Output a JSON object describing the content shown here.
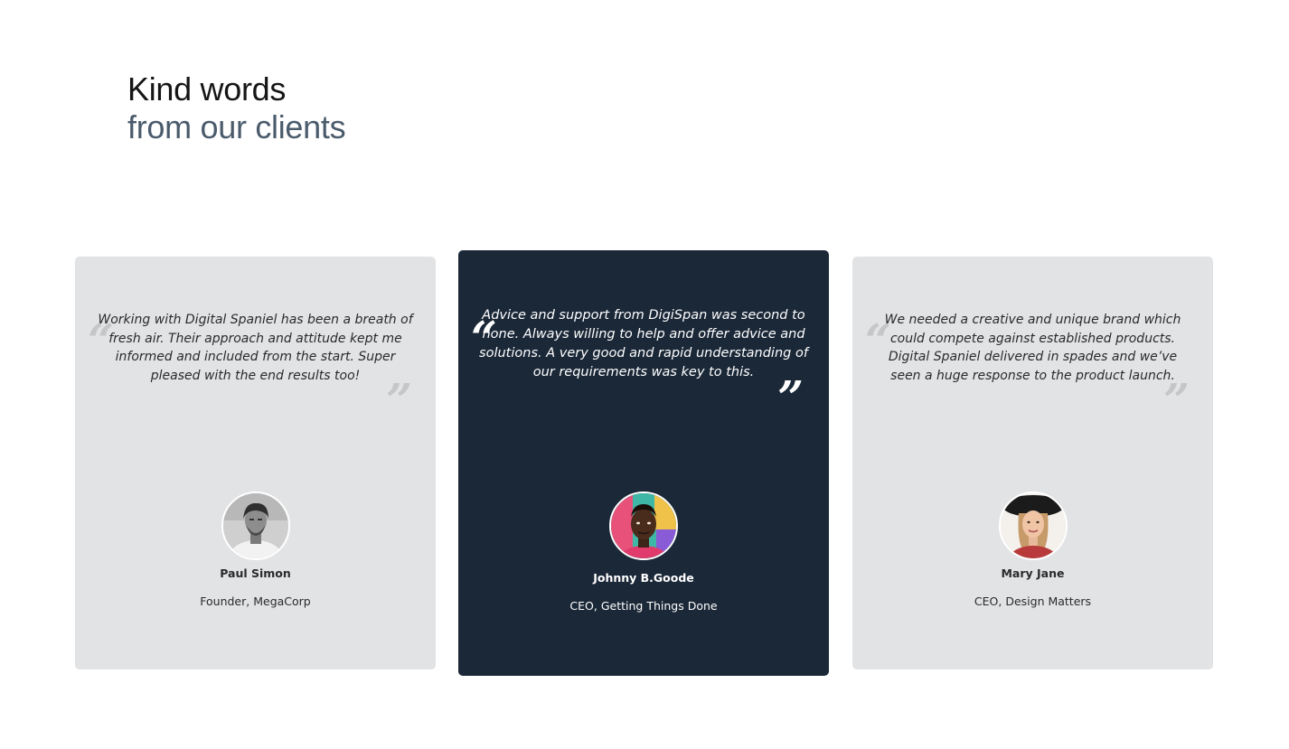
{
  "heading": {
    "line1": "Kind words",
    "line2": "from our clients"
  },
  "testimonials": [
    {
      "quote": "Working with Digital Spaniel has been a breath of fresh air. Their approach and attitude kept me informed and included from the start. Super pleased with the end results too!",
      "name": "Paul Simon",
      "role": "Founder, MegaCorp",
      "theme": "light"
    },
    {
      "quote": "Advice and support from DigiSpan was second to none. Always willing to help and offer advice and solutions. A very good and rapid understanding of our requirements was key to this.",
      "name": "Johnny B.Goode",
      "role": "CEO, Getting Things Done",
      "theme": "dark"
    },
    {
      "quote": "We needed a creative and unique brand which could compete against established products. Digital Spaniel delivered in spades and we’ve seen a huge response to the product launch.",
      "name": "Mary Jane",
      "role": "CEO, Design Matters",
      "theme": "light"
    }
  ],
  "colors": {
    "card_light": "#e2e3e5",
    "card_dark": "#1b2838",
    "heading_primary": "#151515",
    "heading_secondary": "#4a5b6c"
  },
  "icons": {
    "open_quote": "open-quote-icon",
    "close_quote": "close-quote-icon"
  }
}
